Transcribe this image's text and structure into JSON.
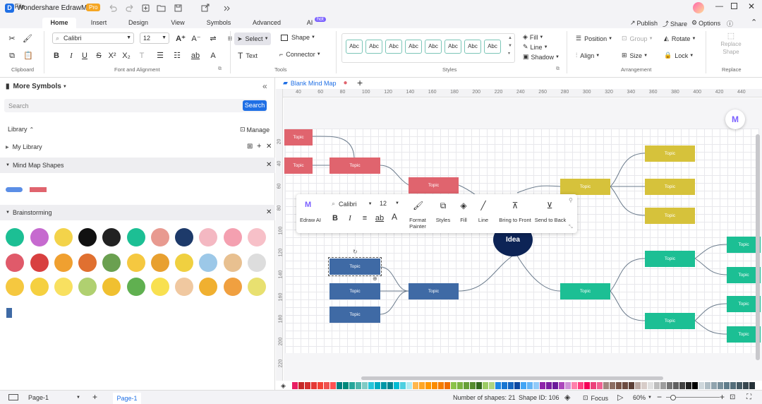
{
  "app": {
    "title": "Wondershare EdrawMax",
    "badge": "Pro"
  },
  "titlebar": {
    "publish": "Publish",
    "share": "Share",
    "options": "Options"
  },
  "menu": {
    "tabs": [
      "File",
      "Home",
      "Insert",
      "Design",
      "View",
      "Symbols",
      "Advanced",
      "AI"
    ],
    "hot_badge": "hot"
  },
  "ribbon": {
    "font_name": "Calibri",
    "font_size": "12",
    "select": "Select",
    "shape": "Shape",
    "text": "Text",
    "connector": "Connector",
    "style_label": "Abc",
    "fill": "Fill",
    "line": "Line",
    "shadow": "Shadow",
    "position": "Position",
    "group": "Group",
    "rotate": "Rotate",
    "align": "Align",
    "size": "Size",
    "lock": "Lock",
    "replace_shape": [
      "Replace",
      "Shape"
    ],
    "groups": {
      "clipboard": "Clipboard",
      "font": "Font and Alignment",
      "tools": "Tools",
      "styles": "Styles",
      "arrangement": "Arrangement",
      "replace": "Replace"
    }
  },
  "left_panel": {
    "title": "More Symbols",
    "search_placeholder": "Search",
    "search_button": "Search",
    "library": "Library",
    "manage": "Manage",
    "my_library": "My Library",
    "mindmap_section": "Mind Map Shapes",
    "brainstorm_section": "Brainstorming"
  },
  "document": {
    "tab": "Blank Mind Map"
  },
  "ruler": {
    "h": [
      "40",
      "60",
      "80",
      "100",
      "120",
      "140",
      "160",
      "180",
      "200",
      "220",
      "240",
      "260",
      "280",
      "300",
      "320",
      "340",
      "360",
      "380",
      "400",
      "420",
      "440"
    ],
    "v": [
      "20",
      "40",
      "60",
      "80",
      "100",
      "120",
      "140",
      "160",
      "180",
      "200",
      "220"
    ]
  },
  "diagram": {
    "center": "Idea",
    "node_label": "Topic"
  },
  "float_toolbar": {
    "ai_label": "Edraw AI",
    "font": "Calibri",
    "size": "12",
    "format_painter": [
      "Format",
      "Painter"
    ],
    "styles": "Styles",
    "fill": "Fill",
    "line": "Line",
    "bring_front": "Bring to Front",
    "send_back": "Send to Back"
  },
  "status": {
    "page_select": "Page-1",
    "page_tab": "Page-1",
    "shapes": "Number of shapes: 21",
    "shape_id": "Shape ID: 106",
    "focus": "Focus",
    "zoom": "60%"
  },
  "palette": [
    "#e91e63",
    "#c62828",
    "#d32f2f",
    "#e53935",
    "#f44336",
    "#ef5350",
    "#ff5252",
    "#008080",
    "#00897b",
    "#26a69a",
    "#4db6ac",
    "#80cbc4",
    "#26c6da",
    "#00acc1",
    "#0097a7",
    "#00838f",
    "#00bcd4",
    "#4dd0e1",
    "#b2ebf2",
    "#ffb74d",
    "#ffa726",
    "#ff9800",
    "#fb8c00",
    "#f57c00",
    "#ef6c00",
    "#8bc34a",
    "#7cb342",
    "#689f38",
    "#558b2f",
    "#33691e",
    "#9ccc65",
    "#aed581",
    "#1e88e5",
    "#1976d2",
    "#1565c0",
    "#0d47a1",
    "#42a5f5",
    "#64b5f6",
    "#90caf9",
    "#8e24aa",
    "#7b1fa2",
    "#6a1b9a",
    "#ab47bc",
    "#ce93d8",
    "#ff80ab",
    "#ff4081",
    "#f50057",
    "#ec407a",
    "#f06292",
    "#a1887f",
    "#8d6e63",
    "#795548",
    "#6d4c41",
    "#5d4037",
    "#bcaaa4",
    "#d7ccc8",
    "#e0e0e0",
    "#bdbdbd",
    "#9e9e9e",
    "#757575",
    "#616161",
    "#424242",
    "#212121",
    "#000000",
    "#cfd8dc",
    "#b0bec5",
    "#90a4ae",
    "#78909c",
    "#607d8b",
    "#546e7a",
    "#455a64",
    "#37474f",
    "#263238",
    "#ffffff"
  ]
}
